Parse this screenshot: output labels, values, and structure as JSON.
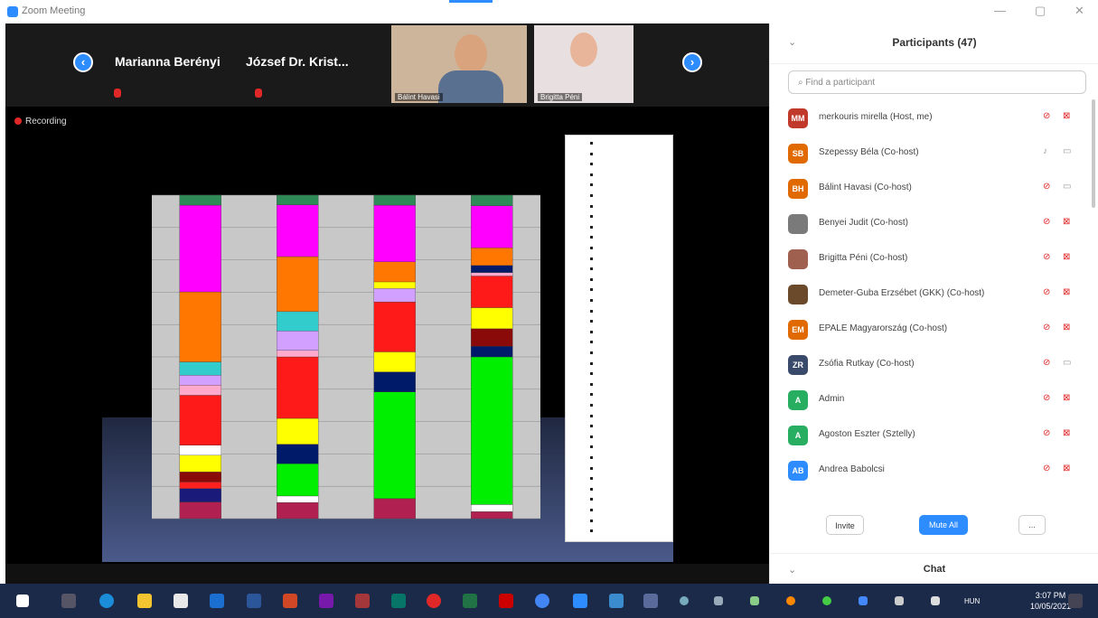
{
  "window": {
    "title": "Zoom Meeting"
  },
  "gallery": {
    "prev_symbol": "‹",
    "next_symbol": "›",
    "tiles": [
      {
        "name": "Marianna Berényi"
      },
      {
        "name": "József Dr. Krist..."
      },
      {
        "name": "Bálint Havasi",
        "has_video": true
      },
      {
        "name": "Brigitta Péni",
        "has_video": true
      }
    ]
  },
  "recording": {
    "label": "Recording"
  },
  "chart_data": {
    "type": "bar",
    "stacked": true,
    "title": "",
    "xlabel": "",
    "ylabel": "",
    "categories": [
      "",
      "",
      "",
      ""
    ],
    "legend_placement": "right",
    "legend_items_count": 38,
    "series_note": "stacked segments per bar (bottom to top), values in percent share",
    "bars": [
      {
        "segments": [
          {
            "color": "#b02050",
            "value": 5
          },
          {
            "color": "#1a1a7a",
            "value": 4
          },
          {
            "color": "#ff2020",
            "value": 2
          },
          {
            "color": "#8a0a0a",
            "value": 3
          },
          {
            "color": "#ffff00",
            "value": 5
          },
          {
            "color": "#ffffff",
            "value": 3
          },
          {
            "color": "#ff1a1a",
            "value": 15
          },
          {
            "color": "#ffaacc",
            "value": 3
          },
          {
            "color": "#d2a0ff",
            "value": 3
          },
          {
            "color": "#33cccc",
            "value": 4
          },
          {
            "color": "#ff7700",
            "value": 21
          },
          {
            "color": "#ff00ff",
            "value": 26
          },
          {
            "color": "#2e8b57",
            "value": 3
          }
        ]
      },
      {
        "segments": [
          {
            "color": "#b02050",
            "value": 5
          },
          {
            "color": "#ffffff",
            "value": 2
          },
          {
            "color": "#00ee00",
            "value": 10
          },
          {
            "color": "#001a6a",
            "value": 6
          },
          {
            "color": "#ffff00",
            "value": 8
          },
          {
            "color": "#ff1a1a",
            "value": 19
          },
          {
            "color": "#ffaacc",
            "value": 2
          },
          {
            "color": "#d2a0ff",
            "value": 6
          },
          {
            "color": "#33cccc",
            "value": 6
          },
          {
            "color": "#ff7700",
            "value": 17
          },
          {
            "color": "#ff00ff",
            "value": 16
          },
          {
            "color": "#2e8b57",
            "value": 3
          }
        ]
      },
      {
        "segments": [
          {
            "color": "#b02050",
            "value": 6
          },
          {
            "color": "#00ee00",
            "value": 32
          },
          {
            "color": "#001a6a",
            "value": 6
          },
          {
            "color": "#ffff00",
            "value": 6
          },
          {
            "color": "#ff1a1a",
            "value": 15
          },
          {
            "color": "#d2a0ff",
            "value": 4
          },
          {
            "color": "#ffff00",
            "value": 2
          },
          {
            "color": "#ff7700",
            "value": 6
          },
          {
            "color": "#ff00ff",
            "value": 17
          },
          {
            "color": "#2e8b57",
            "value": 3
          }
        ]
      },
      {
        "segments": [
          {
            "color": "#b02050",
            "value": 2
          },
          {
            "color": "#ffffff",
            "value": 2
          },
          {
            "color": "#00ee00",
            "value": 42
          },
          {
            "color": "#001a6a",
            "value": 3
          },
          {
            "color": "#8a0a0a",
            "value": 5
          },
          {
            "color": "#ffff00",
            "value": 6
          },
          {
            "color": "#ff1a1a",
            "value": 9
          },
          {
            "color": "#ffaacc",
            "value": 1
          },
          {
            "color": "#001a6a",
            "value": 2
          },
          {
            "color": "#ff7700",
            "value": 5
          },
          {
            "color": "#ff00ff",
            "value": 12
          },
          {
            "color": "#2e8b57",
            "value": 3
          }
        ]
      }
    ]
  },
  "participants": {
    "title": "Participants (47)",
    "search_placeholder": "Find a participant",
    "list": [
      {
        "name": "merkouris mirella (Host, me)",
        "initials": "MM",
        "color": "#c0392b",
        "mic": "off",
        "video": "off"
      },
      {
        "name": "Szepessy Béla (Co-host)",
        "initials": "SB",
        "color": "#e06a00",
        "mic": "on",
        "video": "on"
      },
      {
        "name": "Bálint Havasi (Co-host)",
        "initials": "BH",
        "color": "#e06a00",
        "mic": "off",
        "video": "on"
      },
      {
        "name": "Benyei Judit (Co-host)",
        "initials": "",
        "color": "#7a7a7a",
        "mic": "off",
        "video": "off"
      },
      {
        "name": "Brigitta Péni (Co-host)",
        "initials": "",
        "color": "#a06050",
        "mic": "off",
        "video": "off"
      },
      {
        "name": "Demeter-Guba Erzsébet (GKK) (Co-host)",
        "initials": "",
        "color": "#6a4a2a",
        "mic": "off",
        "video": "off"
      },
      {
        "name": "EPALE Magyarország (Co-host)",
        "initials": "EM",
        "color": "#e06a00",
        "mic": "off",
        "video": "off"
      },
      {
        "name": "Zsófia Rutkay (Co-host)",
        "initials": "ZR",
        "color": "#3a4a6a",
        "mic": "off",
        "video": "on"
      },
      {
        "name": "Admin",
        "initials": "A",
        "color": "#27ae60",
        "mic": "off",
        "video": "off"
      },
      {
        "name": "Agoston Eszter (Sztelly)",
        "initials": "A",
        "color": "#27ae60",
        "mic": "off",
        "video": "off"
      },
      {
        "name": "Andrea Babolcsi",
        "initials": "AB",
        "color": "#2d8cff",
        "mic": "off",
        "video": "off"
      }
    ],
    "invite_label": "Invite",
    "mute_all_label": "Mute All",
    "more_label": "..."
  },
  "chat": {
    "title": "Chat"
  },
  "taskbar": {
    "language": "HUN",
    "time": "3:07 PM",
    "date": "10/05/2021"
  }
}
